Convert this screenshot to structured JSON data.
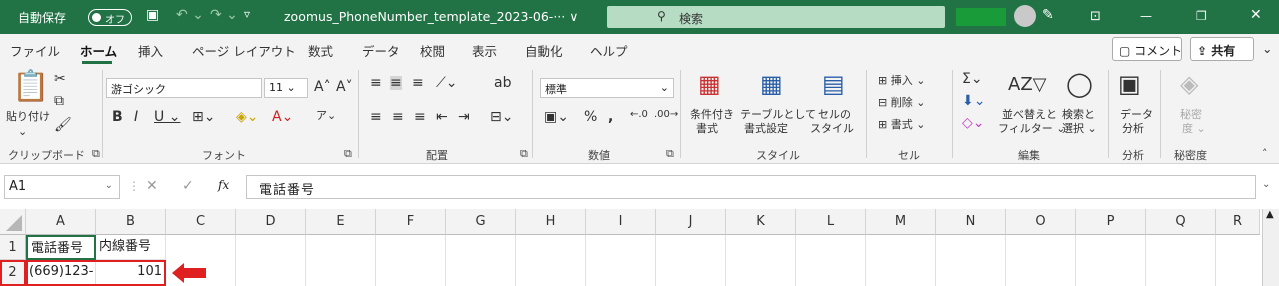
{
  "titlebar": {
    "autosave": "自動保存",
    "toggle": "オフ",
    "filename": "zoomus_PhoneNumber_template_2023-06-··· ∨",
    "search": "検索"
  },
  "tabs": [
    "ファイル",
    "ホーム",
    "挿入",
    "ページ レイアウト",
    "数式",
    "データ",
    "校閲",
    "表示",
    "自動化",
    "ヘルプ"
  ],
  "comment_btn": "コメント",
  "share_btn": "共有",
  "ribbon": {
    "clipboard": {
      "paste": "貼り付け",
      "label": "クリップボード"
    },
    "font": {
      "name": "游ゴシック",
      "size": "11",
      "label": "フォント"
    },
    "alignment": {
      "label": "配置"
    },
    "number": {
      "format": "標準",
      "label": "数値"
    },
    "styles": {
      "cond": "条件付き",
      "cond2": "書式",
      "table": "テーブルとして",
      "table2": "書式設定",
      "cellstyle": "セルの",
      "cellstyle2": "スタイル",
      "label": "スタイル"
    },
    "cells": {
      "insert": "挿入",
      "delete": "削除",
      "format": "書式",
      "label": "セル"
    },
    "editing": {
      "sort": "並べ替えと",
      "sort2": "フィルター",
      "find": "検索と",
      "find2": "選択",
      "label": "編集"
    },
    "analysis": {
      "btn": "データ",
      "btn2": "分析",
      "label": "分析"
    },
    "sensitivity": {
      "btn": "秘密",
      "btn2": "度",
      "label": "秘密度"
    }
  },
  "formula_bar": {
    "namebox": "A1",
    "fx": "fx",
    "content": "電話番号"
  },
  "columns": [
    "A",
    "B",
    "C",
    "D",
    "E",
    "F",
    "G",
    "H",
    "I",
    "J",
    "K",
    "L",
    "M",
    "N",
    "O",
    "P",
    "Q",
    "R"
  ],
  "rows": [
    {
      "num": "1",
      "cells": [
        "電話番号",
        "内線番号"
      ]
    },
    {
      "num": "2",
      "cells": [
        "(669)123-",
        "101"
      ]
    }
  ],
  "colors": {
    "excel_green": "#217346",
    "highlight": "#e02020"
  }
}
